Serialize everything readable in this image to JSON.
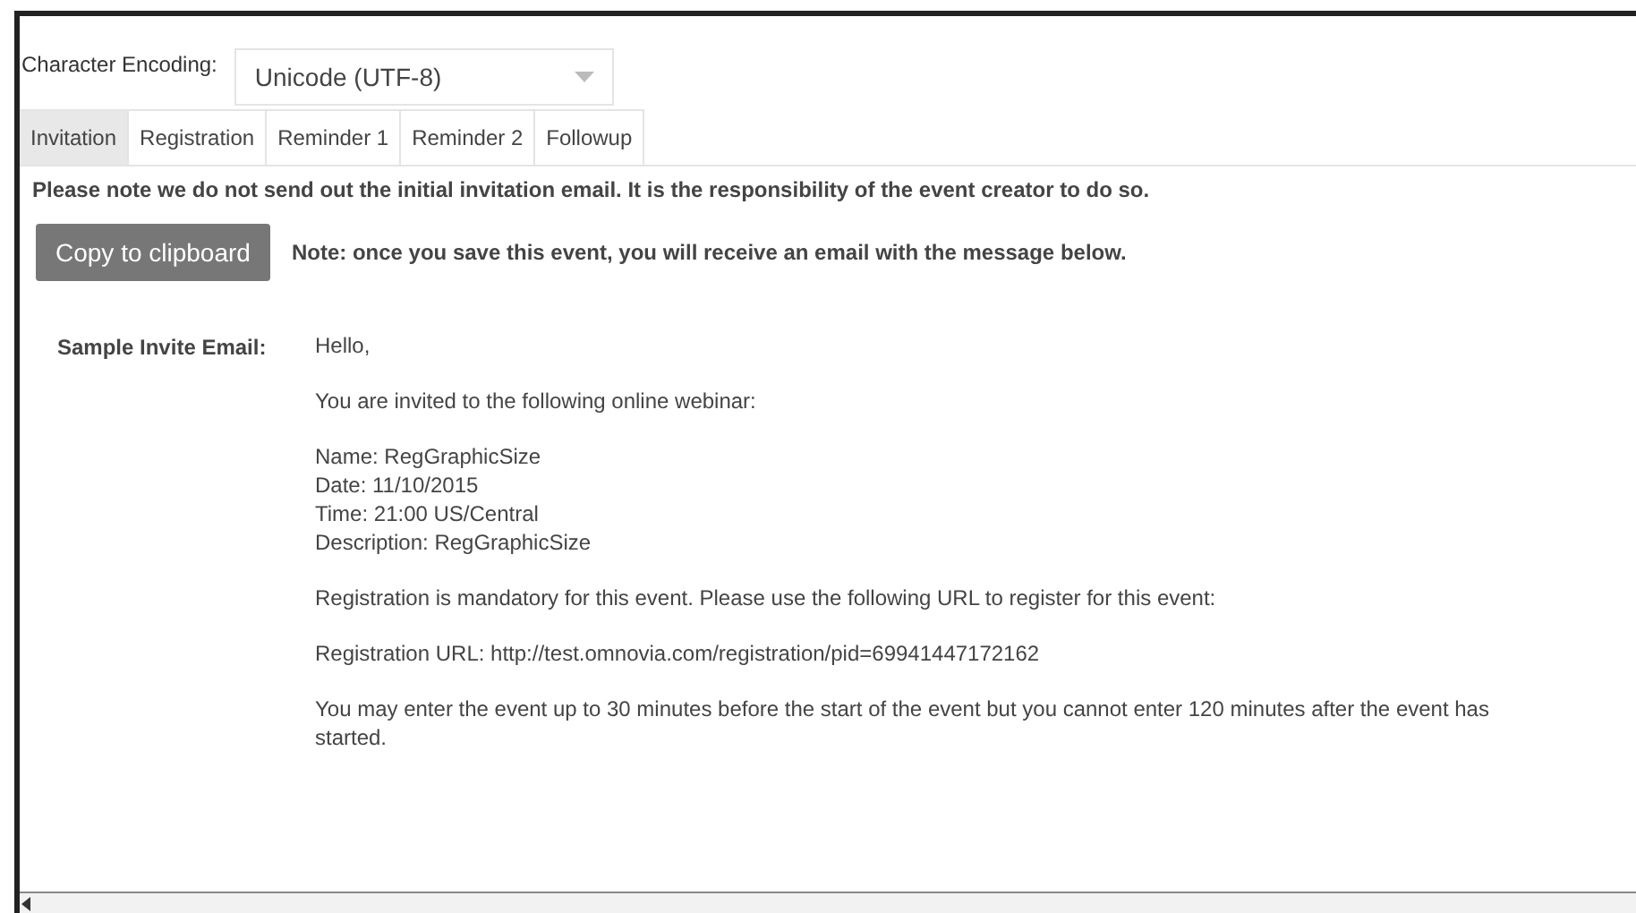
{
  "encoding": {
    "label": "Character Encoding:",
    "value": "Unicode (UTF-8)"
  },
  "tabs": [
    {
      "label": "Invitation",
      "selected": true
    },
    {
      "label": "Registration",
      "selected": false
    },
    {
      "label": "Reminder 1",
      "selected": false
    },
    {
      "label": "Reminder 2",
      "selected": false
    },
    {
      "label": "Followup",
      "selected": false
    }
  ],
  "notice": "Please note we do not send out the initial invitation email. It is the responsibility of the event creator to do so.",
  "copy_button": "Copy to clipboard",
  "save_note": "Note: once you save this event, you will receive an email with the message below.",
  "sample_label": "Sample Invite Email:",
  "email_paragraphs": [
    [
      "Hello,"
    ],
    [
      "You are invited to the following online webinar:"
    ],
    [
      "Name: RegGraphicSize",
      "Date: 11/10/2015",
      "Time: 21:00 US/Central",
      "Description: RegGraphicSize"
    ],
    [
      "Registration is mandatory for this event. Please use the following URL to register for this event:"
    ],
    [
      "Registration URL: http://test.omnovia.com/registration/pid=69941447172162"
    ],
    [
      "You may enter the event up to 30 minutes before the start of the event but you cannot enter 120 minutes after the event has started."
    ]
  ]
}
